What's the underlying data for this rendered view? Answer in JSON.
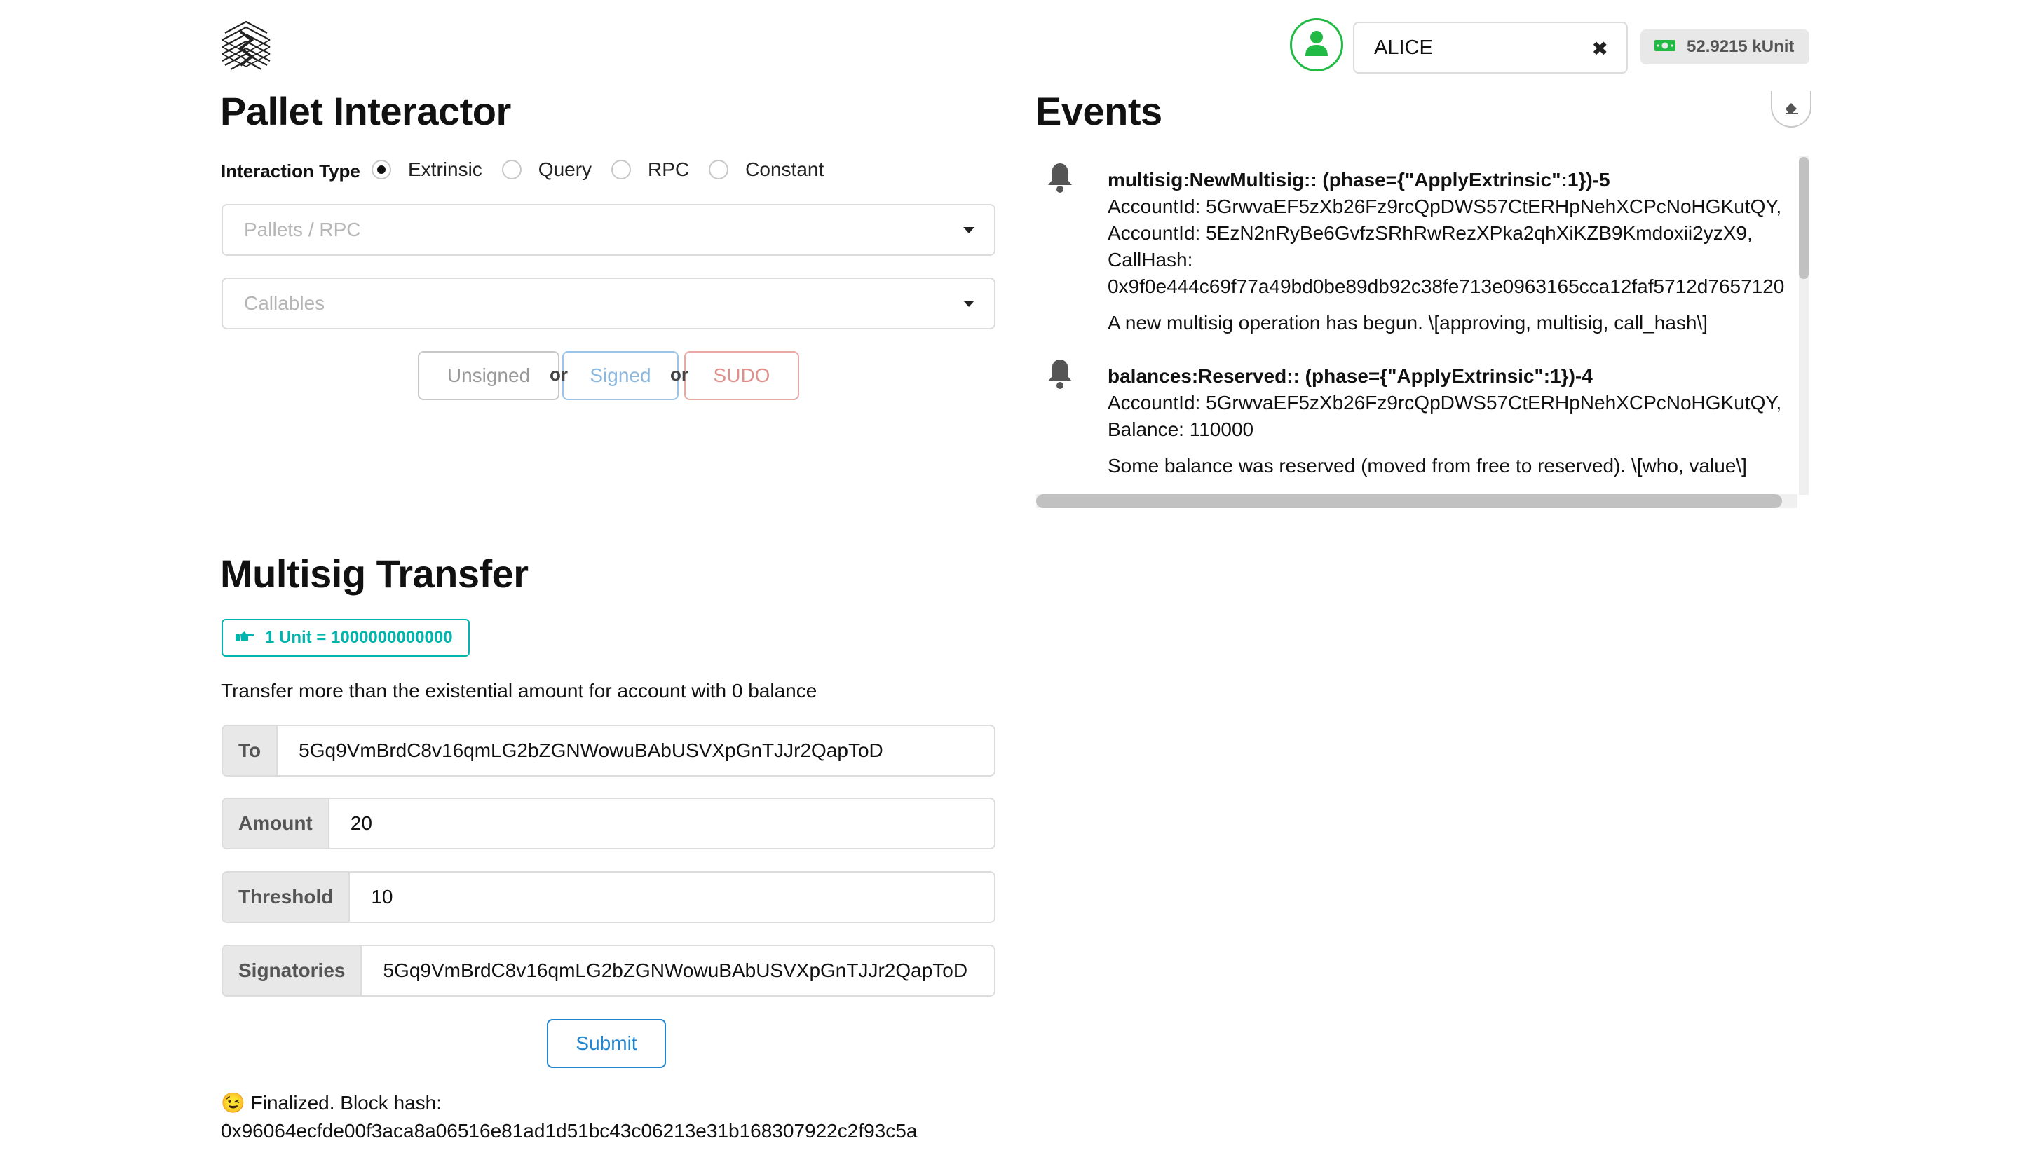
{
  "header": {
    "account_name": "ALICE",
    "clear_glyph": "✖",
    "balance": "52.9215 kUnit",
    "avatar_icon": "user-icon",
    "balance_icon": "money-icon"
  },
  "pallet_interactor": {
    "title": "Pallet Interactor",
    "interaction_type_label": "Interaction Type",
    "interaction_types": [
      {
        "label": "Extrinsic",
        "selected": true
      },
      {
        "label": "Query",
        "selected": false
      },
      {
        "label": "RPC",
        "selected": false
      },
      {
        "label": "Constant",
        "selected": false
      }
    ],
    "pallets_placeholder": "Pallets / RPC",
    "callables_placeholder": "Callables",
    "buttons": {
      "unsigned": "Unsigned",
      "signed": "Signed",
      "sudo": "SUDO",
      "or": "or"
    }
  },
  "events": {
    "title": "Events",
    "items": [
      {
        "title": "multisig:NewMultisig:: (phase={\"ApplyExtrinsic\":1})-5",
        "lines": [
          "AccountId: 5GrwvaEF5zXb26Fz9rcQpDWS57CtERHpNehXCPcNoHGKutQY,",
          "AccountId: 5EzN2nRyBe6GvfzSRhRwRezXPka2qhXiKZB9Kmdoxii2yzX9,",
          "CallHash:",
          "0x9f0e444c69f77a49bd0be89db92c38fe713e0963165cca12faf5712d7657120"
        ],
        "description": "A new multisig operation has begun. \\[approving, multisig, call_hash\\]"
      },
      {
        "title": "balances:Reserved:: (phase={\"ApplyExtrinsic\":1})-4",
        "lines": [
          "AccountId: 5GrwvaEF5zXb26Fz9rcQpDWS57CtERHpNehXCPcNoHGKutQY,",
          "Balance: 110000"
        ],
        "description": "Some balance was reserved (moved from free to reserved). \\[who, value\\]"
      }
    ]
  },
  "multisig": {
    "title": "Multisig Transfer",
    "unit_note": "1 Unit = 1000000000000",
    "description": "Transfer more than the existential amount for account with 0 balance",
    "fields": {
      "to": {
        "label": "To",
        "value": "5Gq9VmBrdC8v16qmLG2bZGNWowuBAbUSVXpGnTJJr2QapToD"
      },
      "amount": {
        "label": "Amount",
        "value": "20"
      },
      "threshold": {
        "label": "Threshold",
        "value": "10"
      },
      "signatories": {
        "label": "Signatories",
        "value": "5Gq9VmBrdC8v16qmLG2bZGNWowuBAbUSVXpGnTJJr2QapToD"
      }
    },
    "submit_label": "Submit",
    "status_emoji": "😉",
    "status_line1": "Finalized. Block hash:",
    "status_line2": "0x96064ecfde00f3aca8a06516e81ad1d51bc43c06213e31b168307922c2f93c5a"
  },
  "colors": {
    "green": "#21ba45",
    "teal": "#00b5ad",
    "blue": "#2185d0",
    "signed_text": "#8cb8e0",
    "sudo_text": "#e0908c"
  }
}
